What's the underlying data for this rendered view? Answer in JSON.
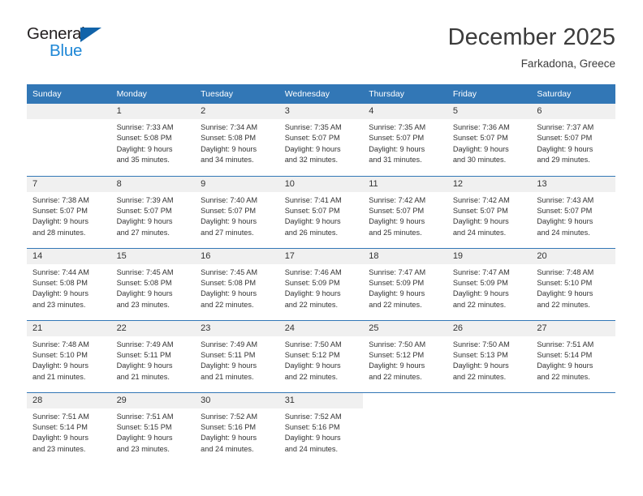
{
  "logo": {
    "word_one": "General",
    "word_two": "Blue",
    "triangle": "triangle-glyph"
  },
  "header": {
    "month_year": "December 2025",
    "location": "Farkadona, Greece"
  },
  "colors": {
    "header_blue": "#3277b6",
    "logo_blue": "#1e87d6",
    "logo_triangle": "#1163a9",
    "daynum_bg": "#f0f0f0",
    "text": "#333333"
  },
  "weekday_headers": [
    "Sunday",
    "Monday",
    "Tuesday",
    "Wednesday",
    "Thursday",
    "Friday",
    "Saturday"
  ],
  "weeks": [
    [
      {
        "day": "",
        "sunrise": "",
        "sunset": "",
        "daylight_line1": "",
        "daylight_line2": "",
        "blank": true
      },
      {
        "day": "1",
        "sunrise": "Sunrise: 7:33 AM",
        "sunset": "Sunset: 5:08 PM",
        "daylight_line1": "Daylight: 9 hours",
        "daylight_line2": "and 35 minutes."
      },
      {
        "day": "2",
        "sunrise": "Sunrise: 7:34 AM",
        "sunset": "Sunset: 5:08 PM",
        "daylight_line1": "Daylight: 9 hours",
        "daylight_line2": "and 34 minutes."
      },
      {
        "day": "3",
        "sunrise": "Sunrise: 7:35 AM",
        "sunset": "Sunset: 5:07 PM",
        "daylight_line1": "Daylight: 9 hours",
        "daylight_line2": "and 32 minutes."
      },
      {
        "day": "4",
        "sunrise": "Sunrise: 7:35 AM",
        "sunset": "Sunset: 5:07 PM",
        "daylight_line1": "Daylight: 9 hours",
        "daylight_line2": "and 31 minutes."
      },
      {
        "day": "5",
        "sunrise": "Sunrise: 7:36 AM",
        "sunset": "Sunset: 5:07 PM",
        "daylight_line1": "Daylight: 9 hours",
        "daylight_line2": "and 30 minutes."
      },
      {
        "day": "6",
        "sunrise": "Sunrise: 7:37 AM",
        "sunset": "Sunset: 5:07 PM",
        "daylight_line1": "Daylight: 9 hours",
        "daylight_line2": "and 29 minutes."
      }
    ],
    [
      {
        "day": "7",
        "sunrise": "Sunrise: 7:38 AM",
        "sunset": "Sunset: 5:07 PM",
        "daylight_line1": "Daylight: 9 hours",
        "daylight_line2": "and 28 minutes."
      },
      {
        "day": "8",
        "sunrise": "Sunrise: 7:39 AM",
        "sunset": "Sunset: 5:07 PM",
        "daylight_line1": "Daylight: 9 hours",
        "daylight_line2": "and 27 minutes."
      },
      {
        "day": "9",
        "sunrise": "Sunrise: 7:40 AM",
        "sunset": "Sunset: 5:07 PM",
        "daylight_line1": "Daylight: 9 hours",
        "daylight_line2": "and 27 minutes."
      },
      {
        "day": "10",
        "sunrise": "Sunrise: 7:41 AM",
        "sunset": "Sunset: 5:07 PM",
        "daylight_line1": "Daylight: 9 hours",
        "daylight_line2": "and 26 minutes."
      },
      {
        "day": "11",
        "sunrise": "Sunrise: 7:42 AM",
        "sunset": "Sunset: 5:07 PM",
        "daylight_line1": "Daylight: 9 hours",
        "daylight_line2": "and 25 minutes."
      },
      {
        "day": "12",
        "sunrise": "Sunrise: 7:42 AM",
        "sunset": "Sunset: 5:07 PM",
        "daylight_line1": "Daylight: 9 hours",
        "daylight_line2": "and 24 minutes."
      },
      {
        "day": "13",
        "sunrise": "Sunrise: 7:43 AM",
        "sunset": "Sunset: 5:07 PM",
        "daylight_line1": "Daylight: 9 hours",
        "daylight_line2": "and 24 minutes."
      }
    ],
    [
      {
        "day": "14",
        "sunrise": "Sunrise: 7:44 AM",
        "sunset": "Sunset: 5:08 PM",
        "daylight_line1": "Daylight: 9 hours",
        "daylight_line2": "and 23 minutes."
      },
      {
        "day": "15",
        "sunrise": "Sunrise: 7:45 AM",
        "sunset": "Sunset: 5:08 PM",
        "daylight_line1": "Daylight: 9 hours",
        "daylight_line2": "and 23 minutes."
      },
      {
        "day": "16",
        "sunrise": "Sunrise: 7:45 AM",
        "sunset": "Sunset: 5:08 PM",
        "daylight_line1": "Daylight: 9 hours",
        "daylight_line2": "and 22 minutes."
      },
      {
        "day": "17",
        "sunrise": "Sunrise: 7:46 AM",
        "sunset": "Sunset: 5:09 PM",
        "daylight_line1": "Daylight: 9 hours",
        "daylight_line2": "and 22 minutes."
      },
      {
        "day": "18",
        "sunrise": "Sunrise: 7:47 AM",
        "sunset": "Sunset: 5:09 PM",
        "daylight_line1": "Daylight: 9 hours",
        "daylight_line2": "and 22 minutes."
      },
      {
        "day": "19",
        "sunrise": "Sunrise: 7:47 AM",
        "sunset": "Sunset: 5:09 PM",
        "daylight_line1": "Daylight: 9 hours",
        "daylight_line2": "and 22 minutes."
      },
      {
        "day": "20",
        "sunrise": "Sunrise: 7:48 AM",
        "sunset": "Sunset: 5:10 PM",
        "daylight_line1": "Daylight: 9 hours",
        "daylight_line2": "and 22 minutes."
      }
    ],
    [
      {
        "day": "21",
        "sunrise": "Sunrise: 7:48 AM",
        "sunset": "Sunset: 5:10 PM",
        "daylight_line1": "Daylight: 9 hours",
        "daylight_line2": "and 21 minutes."
      },
      {
        "day": "22",
        "sunrise": "Sunrise: 7:49 AM",
        "sunset": "Sunset: 5:11 PM",
        "daylight_line1": "Daylight: 9 hours",
        "daylight_line2": "and 21 minutes."
      },
      {
        "day": "23",
        "sunrise": "Sunrise: 7:49 AM",
        "sunset": "Sunset: 5:11 PM",
        "daylight_line1": "Daylight: 9 hours",
        "daylight_line2": "and 21 minutes."
      },
      {
        "day": "24",
        "sunrise": "Sunrise: 7:50 AM",
        "sunset": "Sunset: 5:12 PM",
        "daylight_line1": "Daylight: 9 hours",
        "daylight_line2": "and 22 minutes."
      },
      {
        "day": "25",
        "sunrise": "Sunrise: 7:50 AM",
        "sunset": "Sunset: 5:12 PM",
        "daylight_line1": "Daylight: 9 hours",
        "daylight_line2": "and 22 minutes."
      },
      {
        "day": "26",
        "sunrise": "Sunrise: 7:50 AM",
        "sunset": "Sunset: 5:13 PM",
        "daylight_line1": "Daylight: 9 hours",
        "daylight_line2": "and 22 minutes."
      },
      {
        "day": "27",
        "sunrise": "Sunrise: 7:51 AM",
        "sunset": "Sunset: 5:14 PM",
        "daylight_line1": "Daylight: 9 hours",
        "daylight_line2": "and 22 minutes."
      }
    ],
    [
      {
        "day": "28",
        "sunrise": "Sunrise: 7:51 AM",
        "sunset": "Sunset: 5:14 PM",
        "daylight_line1": "Daylight: 9 hours",
        "daylight_line2": "and 23 minutes."
      },
      {
        "day": "29",
        "sunrise": "Sunrise: 7:51 AM",
        "sunset": "Sunset: 5:15 PM",
        "daylight_line1": "Daylight: 9 hours",
        "daylight_line2": "and 23 minutes."
      },
      {
        "day": "30",
        "sunrise": "Sunrise: 7:52 AM",
        "sunset": "Sunset: 5:16 PM",
        "daylight_line1": "Daylight: 9 hours",
        "daylight_line2": "and 24 minutes."
      },
      {
        "day": "31",
        "sunrise": "Sunrise: 7:52 AM",
        "sunset": "Sunset: 5:16 PM",
        "daylight_line1": "Daylight: 9 hours",
        "daylight_line2": "and 24 minutes."
      },
      {
        "day": "",
        "sunrise": "",
        "sunset": "",
        "daylight_line1": "",
        "daylight_line2": "",
        "blank": true,
        "nofill": true
      },
      {
        "day": "",
        "sunrise": "",
        "sunset": "",
        "daylight_line1": "",
        "daylight_line2": "",
        "blank": true,
        "nofill": true
      },
      {
        "day": "",
        "sunrise": "",
        "sunset": "",
        "daylight_line1": "",
        "daylight_line2": "",
        "blank": true,
        "nofill": true
      }
    ]
  ]
}
